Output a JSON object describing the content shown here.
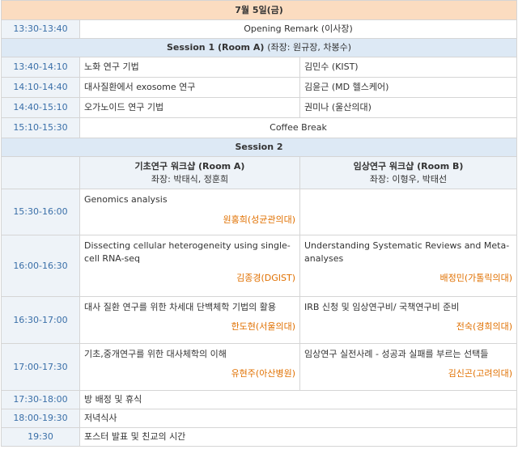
{
  "date_header": "7월 5일(금)",
  "opening": {
    "time": "13:30-13:40",
    "title": "Opening Remark (이사장)"
  },
  "session1": {
    "title": "Session 1 (Room A)",
    "chairs": "(좌장: 원규장, 차봉수)",
    "rows": [
      {
        "time": "13:40-14:10",
        "title": "노화 연구 기법",
        "speaker": "김민수 (KIST)"
      },
      {
        "time": "14:10-14:40",
        "title": "대사질환에서 exosome 연구",
        "speaker": "김윤근 (MD 헬스케어)"
      },
      {
        "time": "14:40-15:10",
        "title": "오가노이드 연구 기법",
        "speaker": "권미나 (울산의대)"
      }
    ]
  },
  "coffee": {
    "time": "15:10-15:30",
    "title": "Coffee Break"
  },
  "session2": {
    "title": "Session 2",
    "room_a": {
      "title": "기초연구 워크샵 (Room A)",
      "chairs": "좌장: 박태식, 정훈희"
    },
    "room_b": {
      "title": "임상연구 워크샵 (Room B)",
      "chairs": "좌장: 이형우, 박태선"
    },
    "rows": [
      {
        "time": "15:30-16:00",
        "a_title": "Genomics analysis",
        "a_speaker": "원홍희(성균관의대)",
        "b_title": "",
        "b_speaker": ""
      },
      {
        "time": "16:00-16:30",
        "a_title": "Dissecting cellular heterogeneity using single-cell RNA-seq",
        "a_speaker": "김종경(DGIST)",
        "b_title": "Understanding Systematic Reviews and Meta-analyses",
        "b_speaker": "배정민(가톨릭의대)"
      },
      {
        "time": "16:30-17:00",
        "a_title": "대사 질환 연구를 위한 차세대 단백체학 기법의 활용",
        "a_speaker": "한도현(서울의대)",
        "b_title": "IRB 신청 및 임상연구비/ 국책연구비 준비",
        "b_speaker": "전숙(경희의대)"
      },
      {
        "time": "17:00-17:30",
        "a_title": "기초,중개연구를 위한 대사체학의 이해",
        "a_speaker": "유현주(아산병원)",
        "b_title": "임상연구 실전사례 - 성공과 실패를 부르는 선택들",
        "b_speaker": "김신곤(고려의대)"
      }
    ]
  },
  "after": [
    {
      "time": "17:30-18:00",
      "title": "방 배정 및 휴식"
    },
    {
      "time": "18:00-19:30",
      "title": "저녁식사"
    },
    {
      "time": "19:30",
      "title": "포스터 발표 및 친교의 시간"
    }
  ]
}
